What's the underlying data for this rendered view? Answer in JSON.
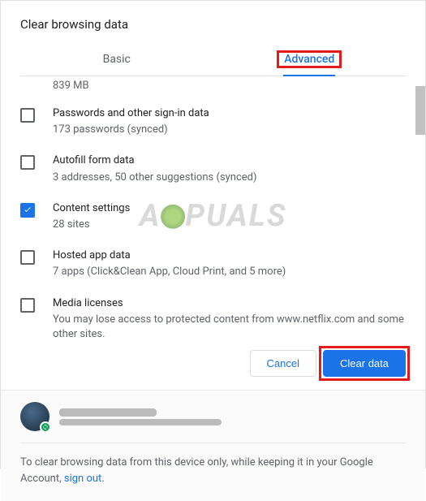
{
  "dialog": {
    "title": "Clear browsing data"
  },
  "tabs": {
    "basic": "Basic",
    "advanced": "Advanced"
  },
  "partial_top": "839 MB",
  "items": [
    {
      "title": "Passwords and other sign-in data",
      "sub": "173 passwords (synced)",
      "checked": false
    },
    {
      "title": "Autofill form data",
      "sub": "3 addresses, 50 other suggestions (synced)",
      "checked": false
    },
    {
      "title": "Content settings",
      "sub": "28 sites",
      "checked": true
    },
    {
      "title": "Hosted app data",
      "sub": "7 apps (Click&Clean App, Cloud Print, and 5 more)",
      "checked": false
    },
    {
      "title": "Media licenses",
      "sub": "You may lose access to protected content from www.netflix.com and some other sites.",
      "checked": false
    }
  ],
  "buttons": {
    "cancel": "Cancel",
    "clear": "Clear data"
  },
  "footer": {
    "text_before": "To clear browsing data from this device only, while keeping it in your Google Account, ",
    "link": "sign out",
    "text_after": "."
  },
  "watermark": "A  PUALS"
}
